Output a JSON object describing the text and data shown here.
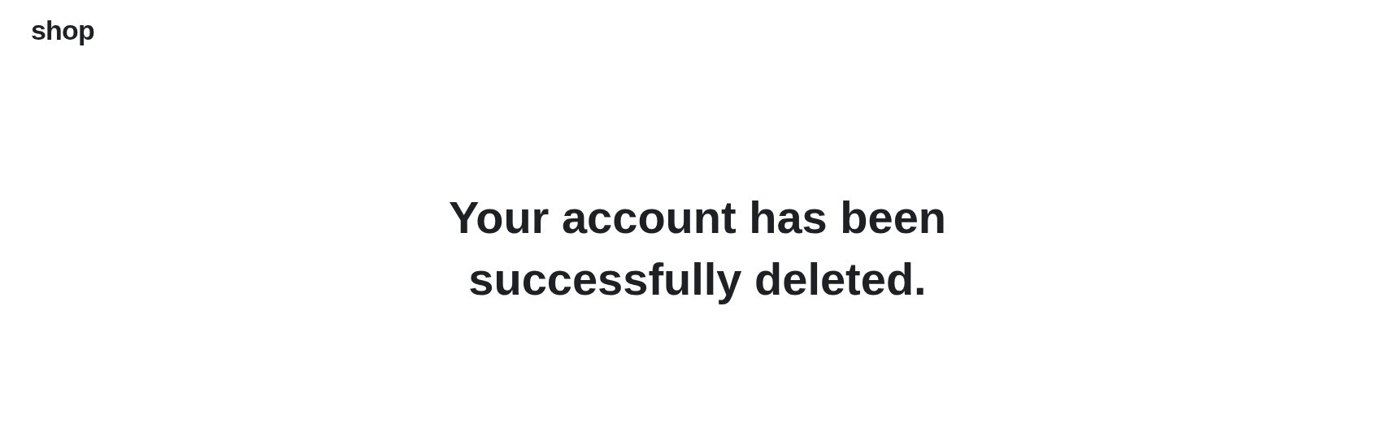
{
  "header": {
    "logo": "shop"
  },
  "message": {
    "heading": "Your account has been successfully deleted."
  }
}
